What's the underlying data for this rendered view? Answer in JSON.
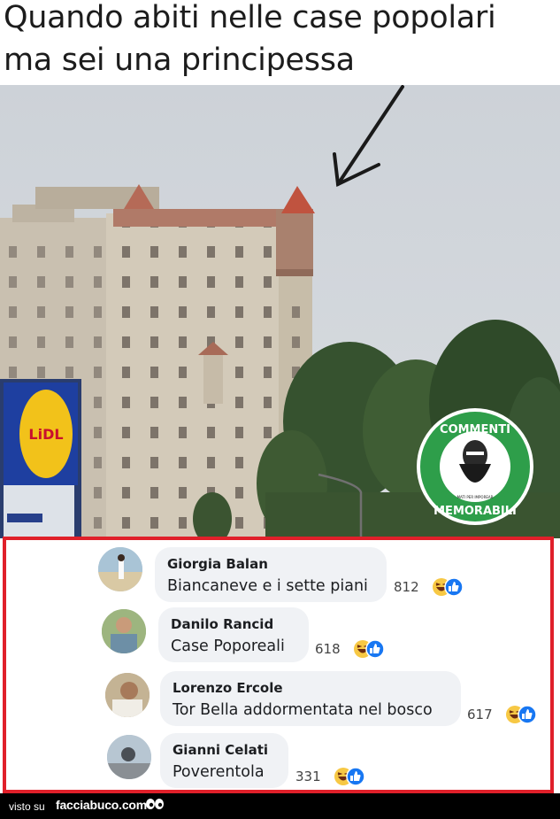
{
  "caption": {
    "line1": "Quando abiti nelle case popolari",
    "line2": "ma sei una principessa"
  },
  "photo": {
    "store_sign": "LiDL",
    "badge_top_text": "COMMENTI",
    "badge_bottom_text": "MEMORABILI",
    "badge_small_text": "MATI PER IMPOREAR"
  },
  "comments": [
    {
      "name": "Giorgia Balan",
      "text": "Biancaneve e i sette piani",
      "count": "812"
    },
    {
      "name": "Danilo Rancid",
      "text": "Case Poporeali",
      "count": "618"
    },
    {
      "name": "Lorenzo Ercole",
      "text": "Tor Bella addormentata nel bosco",
      "count": "617"
    },
    {
      "name": "Gianni Celati",
      "text": "Poverentola",
      "count": "331"
    }
  ],
  "footer": {
    "visto_su": "visto su",
    "site": "facciabuco.com"
  },
  "colors": {
    "frame_red": "#e0202a",
    "badge_green": "#2e9e4a",
    "like_blue": "#1877f2",
    "haha_yellow": "#f7c844"
  },
  "icons": [
    "arrow-pointer-icon",
    "haha-emoji-icon",
    "like-icon",
    "eyes-icon"
  ]
}
